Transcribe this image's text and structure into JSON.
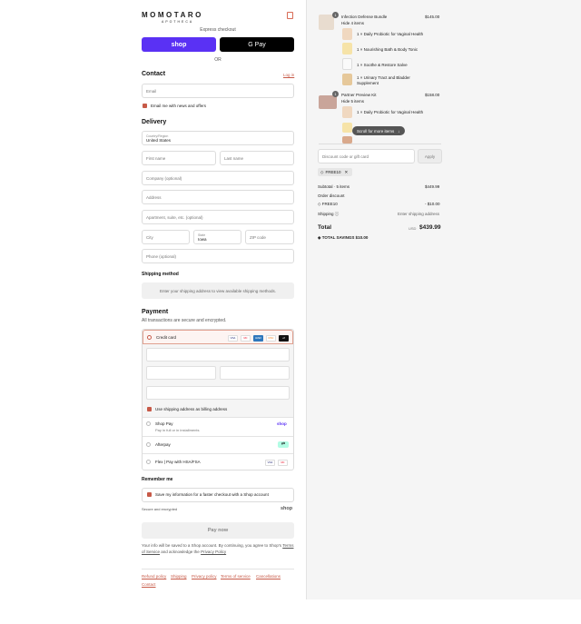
{
  "brand": {
    "name": "MOMOTARO",
    "sub": "APOTHECA"
  },
  "express_checkout": "Express checkout",
  "shop_pay_btn": "shop",
  "gpay_btn": "G Pay",
  "or": "OR",
  "contact": {
    "title": "Contact",
    "login": "Log in",
    "email_placeholder": "Email",
    "news_label": "Email me with news and offers"
  },
  "delivery": {
    "title": "Delivery",
    "country_label": "Country/Region",
    "country_value": "United States",
    "first_name": "First name",
    "last_name": "Last name",
    "company": "Company (optional)",
    "address": "Address",
    "apartment": "Apartment, suite, etc. (optional)",
    "city": "City",
    "state_label": "State",
    "state_value": "Iowa",
    "zip": "ZIP code",
    "phone": "Phone (optional)"
  },
  "shipping_method": {
    "title": "Shipping method",
    "note": "Enter your shipping address to view available shipping methods."
  },
  "payment": {
    "title": "Payment",
    "subtitle": "All transactions are secure and encrypted.",
    "credit_card": "Credit card",
    "cards": [
      "VISA",
      "MC",
      "AMEX",
      "DISC",
      "+8"
    ],
    "billing_label": "Use shipping address as billing address",
    "shop_pay": "Shop Pay",
    "shop_pay_sub": "Pay in full or in installments",
    "shop_pay_logo": "shop",
    "afterpay": "Afterpay",
    "flex": "Flex | Pay with HSA/FSA"
  },
  "remember": {
    "title": "Remember me",
    "label": "Save my information for a faster checkout with a Shop account",
    "secure": "Secure and encrypted",
    "shop_logo": "shop"
  },
  "pay_now": "Pay now",
  "legal": {
    "text1": "Your info will be saved to a Shop account. By continuing, you agree to Shop's",
    "tos": "Terms of Service",
    "and": "and acknowledge the",
    "privacy": "Privacy Policy"
  },
  "footer_links": [
    "Refund policy",
    "Shipping",
    "Privacy policy",
    "Terms of service",
    "Cancellations",
    "Contact"
  ],
  "order": {
    "items": [
      {
        "name": "Infection Defense Bundle",
        "price": "$145.00",
        "qty": "1",
        "toggle": "Hide 4 items",
        "sub": [
          "1 × Daily Probiotic for Vaginal Health",
          "1 × Nourishing Bath & Body Tonic",
          "1 × Soothe & Restore Salve",
          "1 × Urinary Tract and Bladder Supplement"
        ]
      },
      {
        "name": "Partner Preview Kit",
        "price": "$158.00",
        "qty": "1",
        "toggle": "Hide 5 items",
        "sub": [
          "1 × Daily Probiotic for Vaginal Health"
        ]
      }
    ],
    "scroll_hint": "Scroll for more items",
    "discount_placeholder": "Discount code or gift card",
    "apply": "Apply",
    "code_tag": "FREE10",
    "subtotal_label": "Subtotal · 5 items",
    "subtotal": "$449.99",
    "order_discount": "Order discount",
    "discount_code": "FREE10",
    "discount_value": "- $10.00",
    "shipping_label": "Shipping",
    "shipping_value": "Enter shipping address",
    "total_label": "Total",
    "currency": "USD",
    "total": "$439.99",
    "savings_label": "TOTAL SAVINGS",
    "savings": "$10.00"
  }
}
